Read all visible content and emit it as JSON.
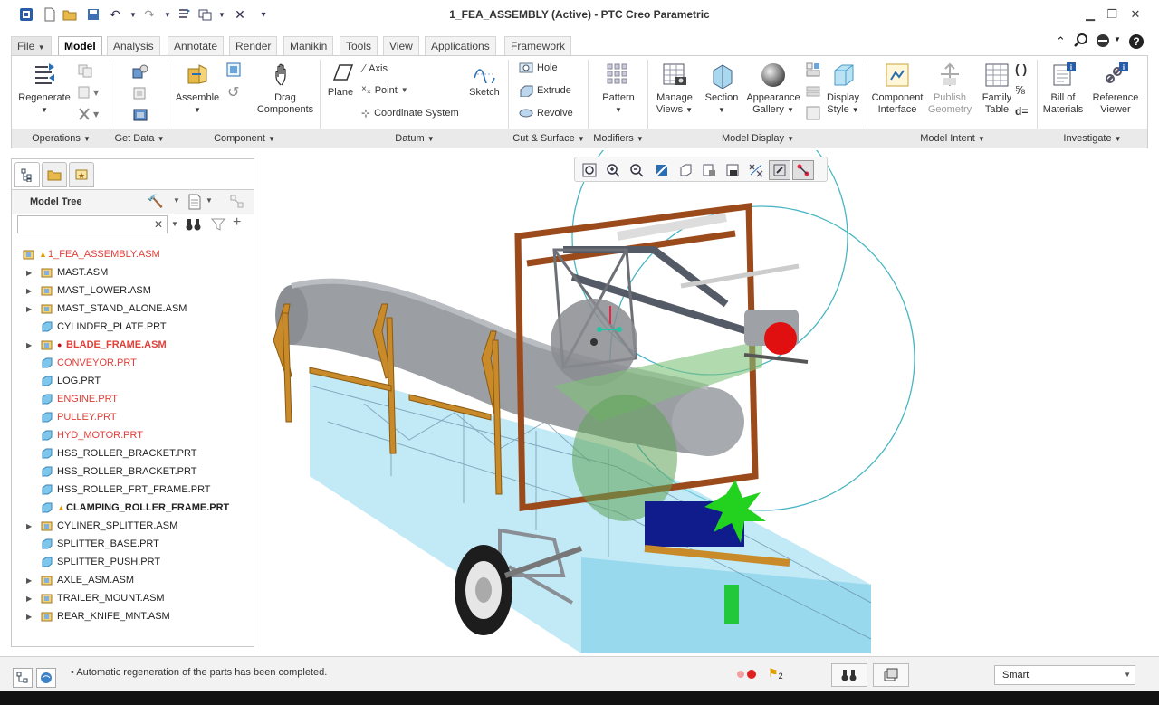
{
  "window": {
    "title": "1_FEA_ASSEMBLY (Active) - PTC Creo Parametric"
  },
  "tabs": [
    {
      "label": "File",
      "active": false
    },
    {
      "label": "Model",
      "active": true
    },
    {
      "label": "Analysis",
      "active": false
    },
    {
      "label": "Annotate",
      "active": false
    },
    {
      "label": "Render",
      "active": false
    },
    {
      "label": "Manikin",
      "active": false
    },
    {
      "label": "Tools",
      "active": false
    },
    {
      "label": "View",
      "active": false
    },
    {
      "label": "Applications",
      "active": false
    },
    {
      "label": "Framework",
      "active": false
    }
  ],
  "ribbon": {
    "regenerate": "Regenerate",
    "assemble": "Assemble",
    "drag_components_1": "Drag",
    "drag_components_2": "Components",
    "axis": "Axis",
    "point": "Point",
    "coordinate_system": "Coordinate System",
    "plane": "Plane",
    "sketch": "Sketch",
    "hole": "Hole",
    "extrude": "Extrude",
    "revolve": "Revolve",
    "pattern": "Pattern",
    "manage_views_1": "Manage",
    "manage_views_2": "Views",
    "section": "Section",
    "appearance_gallery_1": "Appearance",
    "appearance_gallery_2": "Gallery",
    "display_style_1": "Display",
    "display_style_2": "Style",
    "component_interface_1": "Component",
    "component_interface_2": "Interface",
    "publish_geometry_1": "Publish",
    "publish_geometry_2": "Geometry",
    "family_table_1": "Family",
    "family_table_2": "Table",
    "bill_of_materials_1": "Bill of",
    "bill_of_materials_2": "Materials",
    "reference_viewer_1": "Reference",
    "reference_viewer_2": "Viewer",
    "groups": {
      "operations": "Operations",
      "get_data": "Get Data",
      "component": "Component",
      "datum": "Datum",
      "cut_surface": "Cut & Surface",
      "modifiers": "Modifiers",
      "model_display": "Model Display",
      "model_intent": "Model Intent",
      "investigate": "Investigate"
    }
  },
  "model_tree": {
    "header": "Model Tree",
    "search_placeholder": "",
    "items": [
      {
        "label": "1_FEA_ASSEMBLY.ASM",
        "color": "red",
        "expandable": false,
        "flag": "warning"
      },
      {
        "label": "MAST.ASM",
        "color": "normal",
        "expandable": true
      },
      {
        "label": "MAST_LOWER.ASM",
        "color": "normal",
        "expandable": true
      },
      {
        "label": "MAST_STAND_ALONE.ASM",
        "color": "normal",
        "expandable": true
      },
      {
        "label": "CYLINDER_PLATE.PRT",
        "color": "normal",
        "expandable": false
      },
      {
        "label": "BLADE_FRAME.ASM",
        "color": "red-bold",
        "expandable": true,
        "flag": "error"
      },
      {
        "label": "CONVEYOR.PRT",
        "color": "red",
        "expandable": false
      },
      {
        "label": "LOG.PRT",
        "color": "normal",
        "expandable": false
      },
      {
        "label": "ENGINE.PRT",
        "color": "red",
        "expandable": false
      },
      {
        "label": "PULLEY.PRT",
        "color": "red",
        "expandable": false
      },
      {
        "label": "HYD_MOTOR.PRT",
        "color": "red",
        "expandable": false
      },
      {
        "label": "HSS_ROLLER_BRACKET.PRT",
        "color": "normal",
        "expandable": false
      },
      {
        "label": "HSS_ROLLER_BRACKET.PRT",
        "color": "normal",
        "expandable": false
      },
      {
        "label": "HSS_ROLLER_FRT_FRAME.PRT",
        "color": "normal",
        "expandable": false
      },
      {
        "label": "CLAMPING_ROLLER_FRAME.PRT",
        "color": "bold",
        "expandable": false,
        "flag": "warning"
      },
      {
        "label": "CYLINER_SPLITTER.ASM",
        "color": "normal",
        "expandable": true
      },
      {
        "label": "SPLITTER_BASE.PRT",
        "color": "normal",
        "expandable": false
      },
      {
        "label": "SPLITTER_PUSH.PRT",
        "color": "normal",
        "expandable": false
      },
      {
        "label": "AXLE_ASM.ASM",
        "color": "normal",
        "expandable": true
      },
      {
        "label": "TRAILER_MOUNT.ASM",
        "color": "normal",
        "expandable": true
      },
      {
        "label": "REAR_KNIFE_MNT.ASM",
        "color": "normal",
        "expandable": true
      }
    ]
  },
  "status": {
    "message": "Automatic regeneration of the parts has been completed.",
    "selected_count": "2",
    "filter": "Smart"
  },
  "colors": {
    "accent_blue": "#2a6fb3",
    "frame_brown": "#9b4a1c",
    "conveyor_cyan": "#7fd3ea",
    "error_red": "#e0403a"
  }
}
